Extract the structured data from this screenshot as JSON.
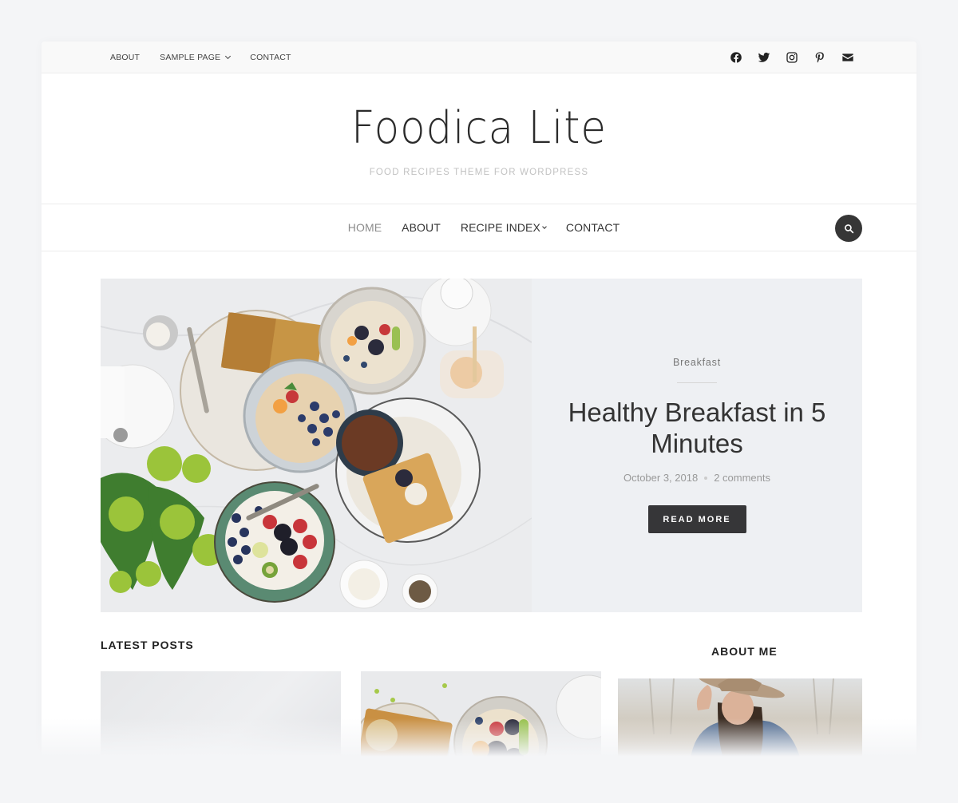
{
  "topbar": {
    "nav": [
      {
        "label": "ABOUT",
        "has_dropdown": false
      },
      {
        "label": "SAMPLE PAGE",
        "has_dropdown": true
      },
      {
        "label": "CONTACT",
        "has_dropdown": false
      }
    ],
    "social": [
      "facebook-icon",
      "twitter-icon",
      "instagram-icon",
      "pinterest-icon",
      "email-icon"
    ]
  },
  "header": {
    "site_title": "Foodica Lite",
    "tagline": "FOOD RECIPES THEME FOR WORDPRESS"
  },
  "main_nav": {
    "items": [
      {
        "label": "HOME",
        "active": true,
        "has_dropdown": false
      },
      {
        "label": "ABOUT",
        "active": false,
        "has_dropdown": false
      },
      {
        "label": "RECIPE INDEX",
        "active": false,
        "has_dropdown": true
      },
      {
        "label": "CONTACT",
        "active": false,
        "has_dropdown": false
      }
    ],
    "search_icon": "search-icon"
  },
  "featured": {
    "category": "Breakfast",
    "title": "Healthy Breakfast in 5 Minutes",
    "date": "October 3, 2018",
    "comments": "2 comments",
    "button_label": "READ MORE",
    "image": "breakfast-table-photo"
  },
  "latest_posts": {
    "heading": "LATEST POSTS",
    "posts": [
      {
        "image": "blank-gray-photo"
      },
      {
        "image": "breakfast-bowls-photo"
      }
    ]
  },
  "sidebar": {
    "about_heading": "ABOUT ME",
    "about_image": "woman-in-hat-photo"
  },
  "colors": {
    "page_bg": "#f4f5f7",
    "accent_dark": "#363638",
    "hero_bg": "#eef0f3",
    "muted_text": "#999999"
  }
}
